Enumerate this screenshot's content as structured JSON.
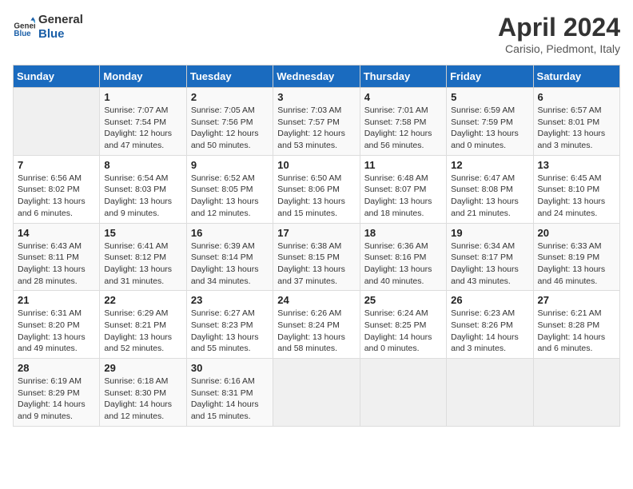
{
  "logo": {
    "line1": "General",
    "line2": "Blue"
  },
  "title": "April 2024",
  "subtitle": "Carisio, Piedmont, Italy",
  "headers": [
    "Sunday",
    "Monday",
    "Tuesday",
    "Wednesday",
    "Thursday",
    "Friday",
    "Saturday"
  ],
  "weeks": [
    [
      {
        "day": "",
        "info": ""
      },
      {
        "day": "1",
        "info": "Sunrise: 7:07 AM\nSunset: 7:54 PM\nDaylight: 12 hours\nand 47 minutes."
      },
      {
        "day": "2",
        "info": "Sunrise: 7:05 AM\nSunset: 7:56 PM\nDaylight: 12 hours\nand 50 minutes."
      },
      {
        "day": "3",
        "info": "Sunrise: 7:03 AM\nSunset: 7:57 PM\nDaylight: 12 hours\nand 53 minutes."
      },
      {
        "day": "4",
        "info": "Sunrise: 7:01 AM\nSunset: 7:58 PM\nDaylight: 12 hours\nand 56 minutes."
      },
      {
        "day": "5",
        "info": "Sunrise: 6:59 AM\nSunset: 7:59 PM\nDaylight: 13 hours\nand 0 minutes."
      },
      {
        "day": "6",
        "info": "Sunrise: 6:57 AM\nSunset: 8:01 PM\nDaylight: 13 hours\nand 3 minutes."
      }
    ],
    [
      {
        "day": "7",
        "info": "Sunrise: 6:56 AM\nSunset: 8:02 PM\nDaylight: 13 hours\nand 6 minutes."
      },
      {
        "day": "8",
        "info": "Sunrise: 6:54 AM\nSunset: 8:03 PM\nDaylight: 13 hours\nand 9 minutes."
      },
      {
        "day": "9",
        "info": "Sunrise: 6:52 AM\nSunset: 8:05 PM\nDaylight: 13 hours\nand 12 minutes."
      },
      {
        "day": "10",
        "info": "Sunrise: 6:50 AM\nSunset: 8:06 PM\nDaylight: 13 hours\nand 15 minutes."
      },
      {
        "day": "11",
        "info": "Sunrise: 6:48 AM\nSunset: 8:07 PM\nDaylight: 13 hours\nand 18 minutes."
      },
      {
        "day": "12",
        "info": "Sunrise: 6:47 AM\nSunset: 8:08 PM\nDaylight: 13 hours\nand 21 minutes."
      },
      {
        "day": "13",
        "info": "Sunrise: 6:45 AM\nSunset: 8:10 PM\nDaylight: 13 hours\nand 24 minutes."
      }
    ],
    [
      {
        "day": "14",
        "info": "Sunrise: 6:43 AM\nSunset: 8:11 PM\nDaylight: 13 hours\nand 28 minutes."
      },
      {
        "day": "15",
        "info": "Sunrise: 6:41 AM\nSunset: 8:12 PM\nDaylight: 13 hours\nand 31 minutes."
      },
      {
        "day": "16",
        "info": "Sunrise: 6:39 AM\nSunset: 8:14 PM\nDaylight: 13 hours\nand 34 minutes."
      },
      {
        "day": "17",
        "info": "Sunrise: 6:38 AM\nSunset: 8:15 PM\nDaylight: 13 hours\nand 37 minutes."
      },
      {
        "day": "18",
        "info": "Sunrise: 6:36 AM\nSunset: 8:16 PM\nDaylight: 13 hours\nand 40 minutes."
      },
      {
        "day": "19",
        "info": "Sunrise: 6:34 AM\nSunset: 8:17 PM\nDaylight: 13 hours\nand 43 minutes."
      },
      {
        "day": "20",
        "info": "Sunrise: 6:33 AM\nSunset: 8:19 PM\nDaylight: 13 hours\nand 46 minutes."
      }
    ],
    [
      {
        "day": "21",
        "info": "Sunrise: 6:31 AM\nSunset: 8:20 PM\nDaylight: 13 hours\nand 49 minutes."
      },
      {
        "day": "22",
        "info": "Sunrise: 6:29 AM\nSunset: 8:21 PM\nDaylight: 13 hours\nand 52 minutes."
      },
      {
        "day": "23",
        "info": "Sunrise: 6:27 AM\nSunset: 8:23 PM\nDaylight: 13 hours\nand 55 minutes."
      },
      {
        "day": "24",
        "info": "Sunrise: 6:26 AM\nSunset: 8:24 PM\nDaylight: 13 hours\nand 58 minutes."
      },
      {
        "day": "25",
        "info": "Sunrise: 6:24 AM\nSunset: 8:25 PM\nDaylight: 14 hours\nand 0 minutes."
      },
      {
        "day": "26",
        "info": "Sunrise: 6:23 AM\nSunset: 8:26 PM\nDaylight: 14 hours\nand 3 minutes."
      },
      {
        "day": "27",
        "info": "Sunrise: 6:21 AM\nSunset: 8:28 PM\nDaylight: 14 hours\nand 6 minutes."
      }
    ],
    [
      {
        "day": "28",
        "info": "Sunrise: 6:19 AM\nSunset: 8:29 PM\nDaylight: 14 hours\nand 9 minutes."
      },
      {
        "day": "29",
        "info": "Sunrise: 6:18 AM\nSunset: 8:30 PM\nDaylight: 14 hours\nand 12 minutes."
      },
      {
        "day": "30",
        "info": "Sunrise: 6:16 AM\nSunset: 8:31 PM\nDaylight: 14 hours\nand 15 minutes."
      },
      {
        "day": "",
        "info": ""
      },
      {
        "day": "",
        "info": ""
      },
      {
        "day": "",
        "info": ""
      },
      {
        "day": "",
        "info": ""
      }
    ]
  ]
}
